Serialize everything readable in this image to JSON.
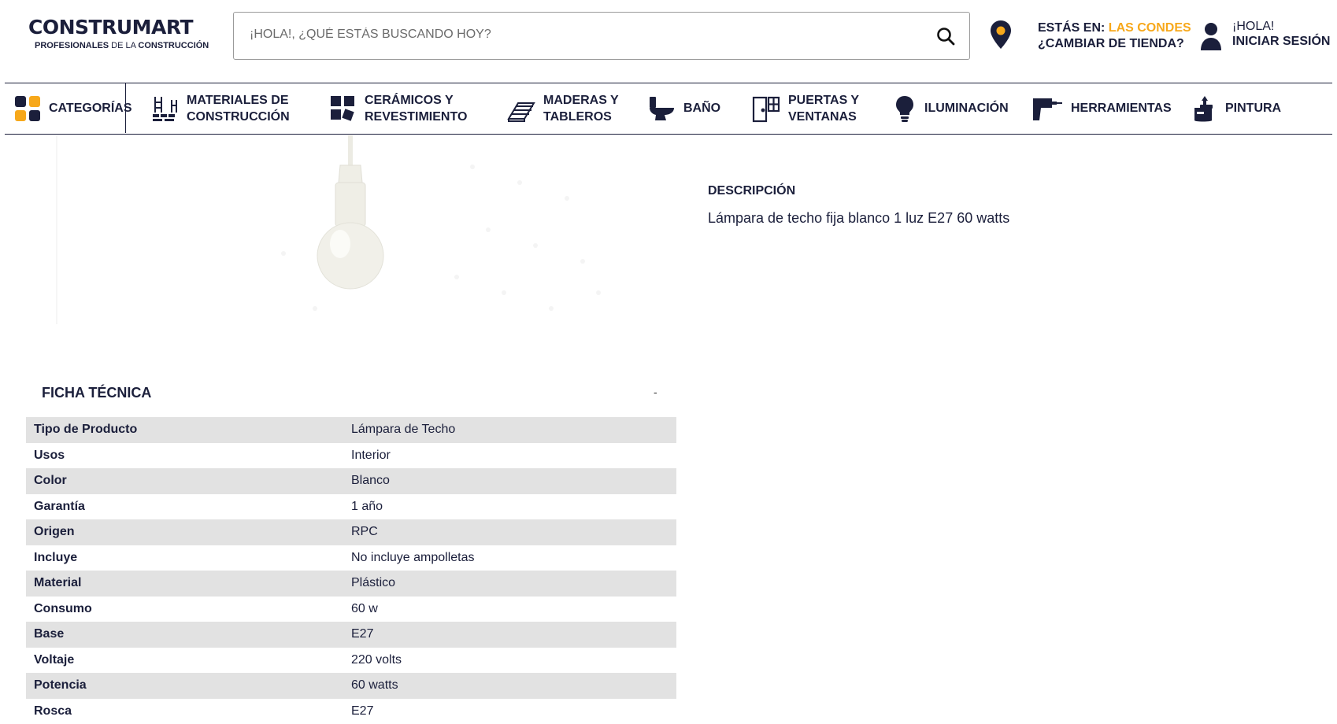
{
  "header": {
    "logo_main": "CONSTRUMART",
    "logo_sub_bold": "PROFESIONALES",
    "logo_sub_thin": " DE LA ",
    "logo_sub_end": "CONSTRUCCIÓN",
    "search_placeholder": "¡HOLA!, ¿QUÉ ESTÁS BUSCANDO HOY?",
    "location_prefix": "ESTÁS EN: ",
    "location_store": "LAS CONDES",
    "change_store": "¿CAMBIAR DE TIENDA?",
    "greeting": "¡HOLA!",
    "login": "INICIAR SESIÓN",
    "accent_color": "#f7a81b",
    "brand_color": "#1b1f3b"
  },
  "nav": {
    "items": [
      {
        "label1": "CATEGORÍAS",
        "label2": "",
        "icon": "grid-icon"
      },
      {
        "label1": "MATERIALES DE",
        "label2": "CONSTRUCCIÓN",
        "icon": "bricks-icon"
      },
      {
        "label1": "CERÁMICOS Y",
        "label2": "REVESTIMIENTO",
        "icon": "tiles-icon"
      },
      {
        "label1": "MADERAS Y",
        "label2": "TABLEROS",
        "icon": "wood-icon"
      },
      {
        "label1": "BAÑO",
        "label2": "",
        "icon": "toilet-icon"
      },
      {
        "label1": "PUERTAS Y",
        "label2": "VENTANAS",
        "icon": "door-icon"
      },
      {
        "label1": "ILUMINACIÓN",
        "label2": "",
        "icon": "bulb-icon"
      },
      {
        "label1": "HERRAMIENTAS",
        "label2": "",
        "icon": "drill-icon"
      },
      {
        "label1": "PINTURA",
        "label2": "",
        "icon": "paint-icon"
      }
    ]
  },
  "description": {
    "title": "DESCRIPCIÓN",
    "text": "Lámpara de techo fija blanco 1 luz E27 60 watts"
  },
  "ficha": {
    "title": "FICHA TÉCNICA",
    "toggle": "-",
    "rows": [
      {
        "k": "Tipo de Producto",
        "v": "Lámpara de Techo"
      },
      {
        "k": "Usos",
        "v": "Interior"
      },
      {
        "k": "Color",
        "v": "Blanco"
      },
      {
        "k": "Garantía",
        "v": "1 año"
      },
      {
        "k": "Origen",
        "v": "RPC"
      },
      {
        "k": "Incluye",
        "v": "No incluye ampolletas"
      },
      {
        "k": "Material",
        "v": "Plástico"
      },
      {
        "k": "Consumo",
        "v": "60 w"
      },
      {
        "k": "Base",
        "v": "E27"
      },
      {
        "k": "Voltaje",
        "v": "220 volts"
      },
      {
        "k": "Potencia",
        "v": "60 watts"
      },
      {
        "k": "Rosca",
        "v": "E27"
      }
    ]
  }
}
